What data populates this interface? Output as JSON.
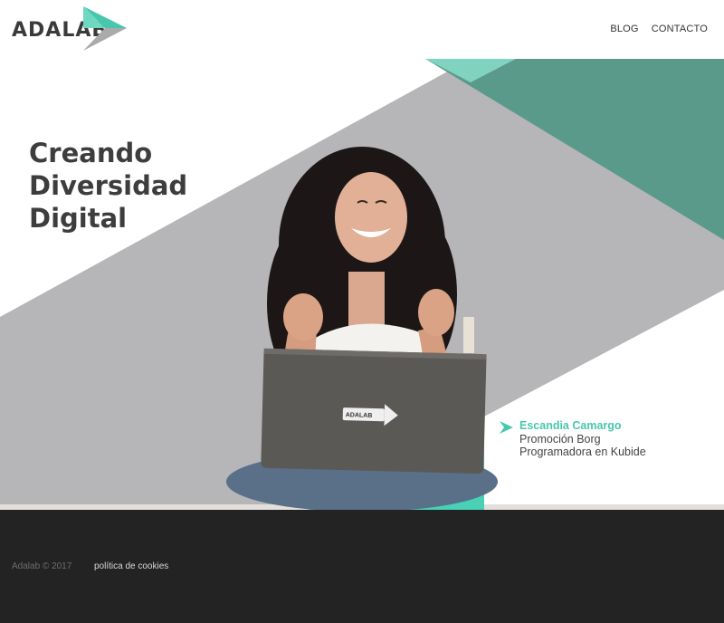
{
  "header": {
    "logo_text": "ADALAB",
    "nav": [
      {
        "label": "BLOG"
      },
      {
        "label": "CONTACTO"
      }
    ]
  },
  "hero": {
    "headline_lines": [
      "Creando",
      "Diversidad",
      "Digital"
    ],
    "laptop_sticker_text": "ADALAB",
    "testimonial": {
      "name": "Escandia Camargo",
      "promotion": "Promoción Borg",
      "role": "Programadora en Kubide"
    }
  },
  "footer": {
    "copyright": "Adalab © 2017",
    "cookies_link": "política de cookies"
  },
  "colors": {
    "accent": "#49c7ad",
    "accent_dark": "#5a9a8a",
    "hero_gray": "#b6b5b8",
    "footer_bg": "#232323",
    "text_dark": "#3d3d3d"
  },
  "icons": [
    "logo-arrow-icon",
    "testimonial-chevron-icon"
  ]
}
